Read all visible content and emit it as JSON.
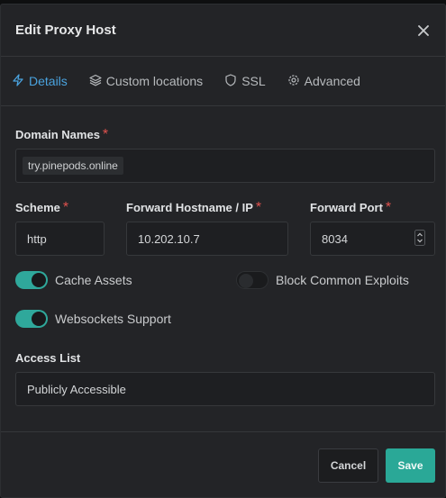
{
  "modal": {
    "title": "Edit Proxy Host"
  },
  "tabs": [
    {
      "label": "Details",
      "icon": "lightning-icon",
      "active": true
    },
    {
      "label": "Custom locations",
      "icon": "layers-icon",
      "active": false
    },
    {
      "label": "SSL",
      "icon": "shield-icon",
      "active": false
    },
    {
      "label": "Advanced",
      "icon": "gear-icon",
      "active": false
    }
  ],
  "form": {
    "domain_names": {
      "label": "Domain Names",
      "required_mark": "*",
      "tags": [
        "try.pinepods.online"
      ]
    },
    "scheme": {
      "label": "Scheme",
      "required_mark": "*",
      "value": "http"
    },
    "forward_host": {
      "label": "Forward Hostname / IP",
      "required_mark": "*",
      "value": "10.202.10.7"
    },
    "forward_port": {
      "label": "Forward Port",
      "required_mark": "*",
      "value": "8034"
    },
    "cache_assets": {
      "label": "Cache Assets",
      "enabled": true
    },
    "block_exploits": {
      "label": "Block Common Exploits",
      "enabled": false
    },
    "websockets": {
      "label": "Websockets Support",
      "enabled": true
    },
    "access_list": {
      "label": "Access List",
      "value": "Publicly Accessible"
    }
  },
  "footer": {
    "cancel_label": "Cancel",
    "save_label": "Save"
  },
  "colors": {
    "accent_teal": "#2aa897",
    "active_tab": "#4aa3df",
    "required": "#e0524e"
  }
}
